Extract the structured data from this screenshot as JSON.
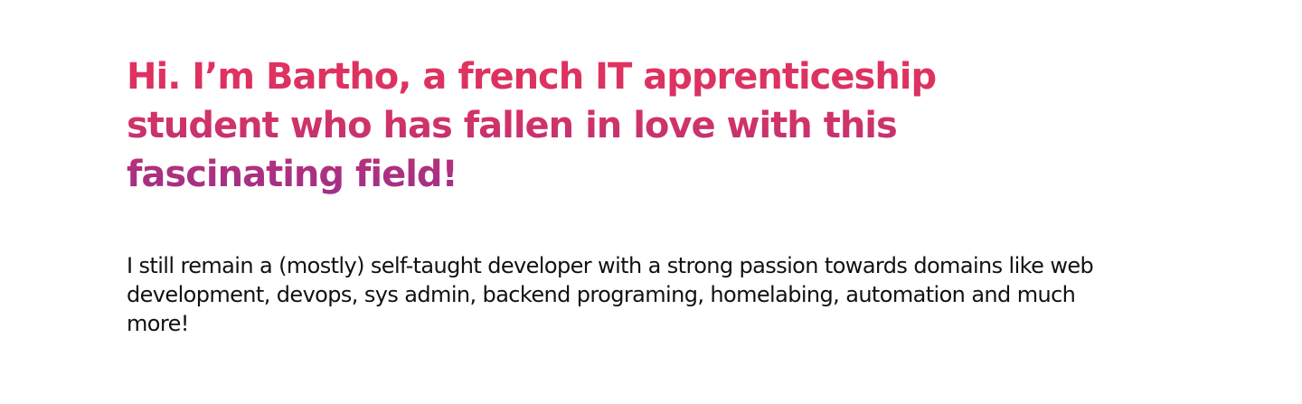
{
  "hero": {
    "headline": "Hi. I’m Bartho, a french IT apprenticeship student who has fallen in love with this fascinating field!",
    "bio": "I still remain a (mostly) self-taught developer with a strong passion towards domains like web development, devops, sys admin, backend programing, homelabing, automation and much more!"
  }
}
